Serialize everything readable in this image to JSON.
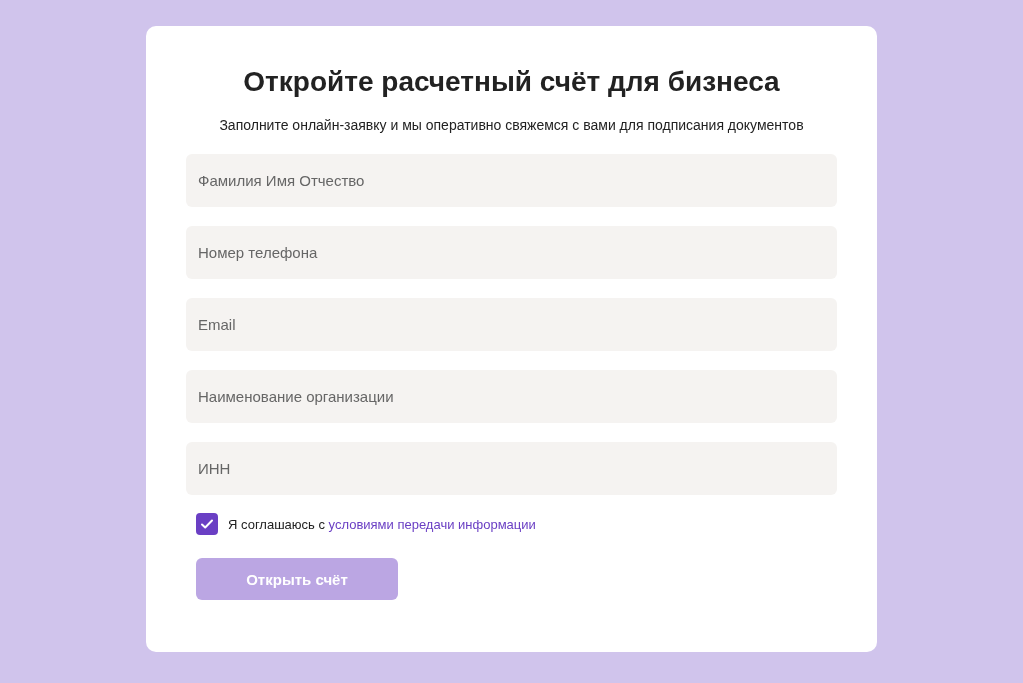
{
  "title": "Откройте расчетный счёт для бизнеса",
  "subtitle": "Заполните онлайн-заявку и мы оперативно свяжемся с вами для подписания документов",
  "fields": [
    {
      "placeholder": "Фамилия Имя Отчество"
    },
    {
      "placeholder": "Номер телефона"
    },
    {
      "placeholder": "Email"
    },
    {
      "placeholder": "Наименование организации"
    },
    {
      "placeholder": "ИНН"
    }
  ],
  "consent": {
    "checked": true,
    "text": "Я соглашаюсь с",
    "link": "условиями передачи информации"
  },
  "submit": {
    "label": "Открыть счёт",
    "disabled": true
  }
}
